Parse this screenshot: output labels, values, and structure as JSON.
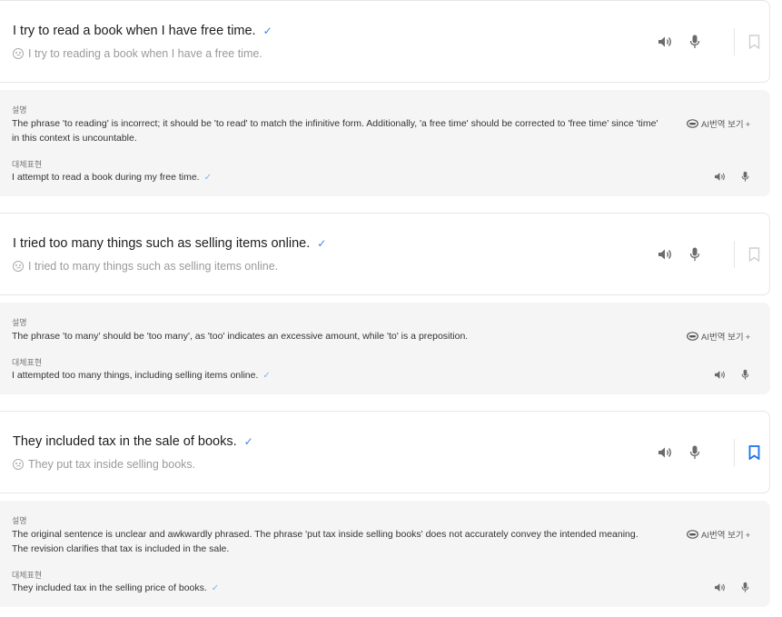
{
  "entries": [
    {
      "corrected": "I try to read a book when I have free time.",
      "original": "I try to reading a book when I have a free time.",
      "explanation_label": "설명",
      "explanation": "The phrase 'to reading' is incorrect; it should be 'to read' to match the infinitive form. Additionally, 'a free time' should be corrected to 'free time' since 'time' in this context is uncountable.",
      "ai_translate_label": "AI번역 보기",
      "ai_translate_plus": "+",
      "alternative_label": "대체표현",
      "alternative": "I attempt to read a book during my free time.",
      "bookmarked": false
    },
    {
      "corrected": "I tried too many things such as selling items online.",
      "original": "I tried to many things such as selling items online.",
      "explanation_label": "설명",
      "explanation": "The phrase 'to many' should be 'too many', as 'too' indicates an excessive amount, while 'to' is a preposition.",
      "ai_translate_label": "AI번역 보기",
      "ai_translate_plus": "+",
      "alternative_label": "대체표현",
      "alternative": "I attempted too many things, including selling items online.",
      "bookmarked": false
    },
    {
      "corrected": "They included tax in the sale of books.",
      "original": "They put tax inside selling books.",
      "explanation_label": "설명",
      "explanation": "The original sentence is unclear and awkwardly phrased. The phrase 'put tax inside selling books' does not accurately convey the intended meaning. The revision clarifies that tax is included in the sale.",
      "ai_translate_label": "AI번역 보기",
      "ai_translate_plus": "+",
      "alternative_label": "대체표현",
      "alternative": "They included tax in the selling price of books.",
      "bookmarked": true
    }
  ],
  "icons": {
    "check": "✓",
    "speaker": "speaker-icon",
    "mic": "mic-icon",
    "bookmark": "bookmark-icon",
    "face": "neutral-face-icon",
    "ai": "ai-translate-icon"
  },
  "colors": {
    "check": "#3b82f6",
    "bookmark_active": "#1a73e8",
    "bookmark_inactive": "#cfcfcf",
    "icon_gray": "#6b6b6b",
    "explain_bg": "#f5f5f5"
  }
}
